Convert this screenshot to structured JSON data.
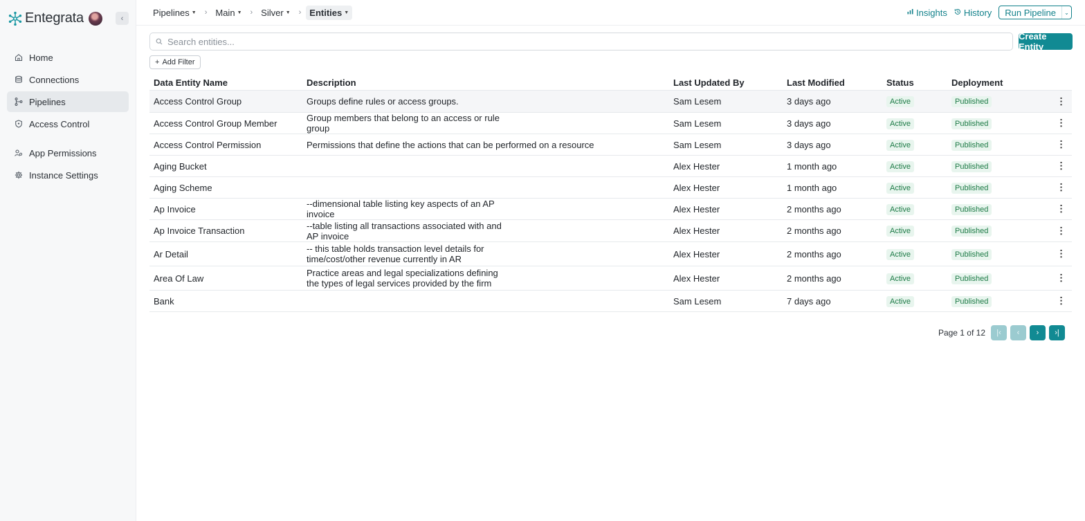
{
  "brand": {
    "name": "Entegrata",
    "logo_icon": "snowflake-logo"
  },
  "sidebar": {
    "collapse_icon": "chevron-left-icon",
    "items": [
      {
        "label": "Home",
        "icon": "home-icon",
        "active": false
      },
      {
        "label": "Connections",
        "icon": "database-icon",
        "active": false
      },
      {
        "label": "Pipelines",
        "icon": "pipeline-icon",
        "active": true
      },
      {
        "label": "Access Control",
        "icon": "shield-icon",
        "active": false
      },
      {
        "label": "App Permissions",
        "icon": "users-icon",
        "active": false
      },
      {
        "label": "Instance Settings",
        "icon": "gear-icon",
        "active": false
      }
    ]
  },
  "breadcrumb": [
    {
      "label": "Pipelines"
    },
    {
      "label": "Main"
    },
    {
      "label": "Silver"
    },
    {
      "label": "Entities"
    }
  ],
  "header": {
    "insights_label": "Insights",
    "history_label": "History",
    "run_label": "Run Pipeline"
  },
  "search": {
    "placeholder": "Search entities...",
    "value": ""
  },
  "create_label": "Create Entity",
  "filter_label": "Add Filter",
  "table": {
    "columns": [
      "Data Entity Name",
      "Description",
      "Last Updated By",
      "Last Modified",
      "Status",
      "Deployment"
    ],
    "rows": [
      {
        "name": "Access Control Group",
        "description": "Groups define rules or access groups.",
        "updated_by": "Sam Lesem",
        "modified": "3 days ago",
        "status": "Active",
        "deployment": "Published"
      },
      {
        "name": "Access Control Group Member",
        "description": "Group members that belong to an access or rule group",
        "updated_by": "Sam Lesem",
        "modified": "3 days ago",
        "status": "Active",
        "deployment": "Published"
      },
      {
        "name": "Access Control Permission",
        "description": "Permissions that define the actions that can be performed on a resource",
        "updated_by": "Sam Lesem",
        "modified": "3 days ago",
        "status": "Active",
        "deployment": "Published"
      },
      {
        "name": "Aging Bucket",
        "description": "",
        "updated_by": "Alex Hester",
        "modified": "1 month ago",
        "status": "Active",
        "deployment": "Published"
      },
      {
        "name": "Aging Scheme",
        "description": "",
        "updated_by": "Alex Hester",
        "modified": "1 month ago",
        "status": "Active",
        "deployment": "Published"
      },
      {
        "name": "Ap Invoice",
        "description": "--dimensional table listing key aspects of an AP invoice",
        "updated_by": "Alex Hester",
        "modified": "2 months ago",
        "status": "Active",
        "deployment": "Published"
      },
      {
        "name": "Ap Invoice Transaction",
        "description": "--table listing all transactions associated with and AP invoice",
        "updated_by": "Alex Hester",
        "modified": "2 months ago",
        "status": "Active",
        "deployment": "Published"
      },
      {
        "name": "Ar Detail",
        "description": "-- this table holds transaction level details for time/cost/other revenue currently in AR",
        "updated_by": "Alex Hester",
        "modified": "2 months ago",
        "status": "Active",
        "deployment": "Published"
      },
      {
        "name": "Area Of Law",
        "description": "Practice areas and legal specializations defining the types of legal services provided by the firm",
        "updated_by": "Alex Hester",
        "modified": "2 months ago",
        "status": "Active",
        "deployment": "Published"
      },
      {
        "name": "Bank",
        "description": "",
        "updated_by": "Sam Lesem",
        "modified": "7 days ago",
        "status": "Active",
        "deployment": "Published"
      }
    ]
  },
  "pagination": {
    "label": "Page 1 of 12",
    "current": 1,
    "total": 12
  },
  "colors": {
    "accent": "#118a93",
    "active_badge_bg": "#e8f5ee",
    "active_badge_text": "#1c7a45"
  }
}
